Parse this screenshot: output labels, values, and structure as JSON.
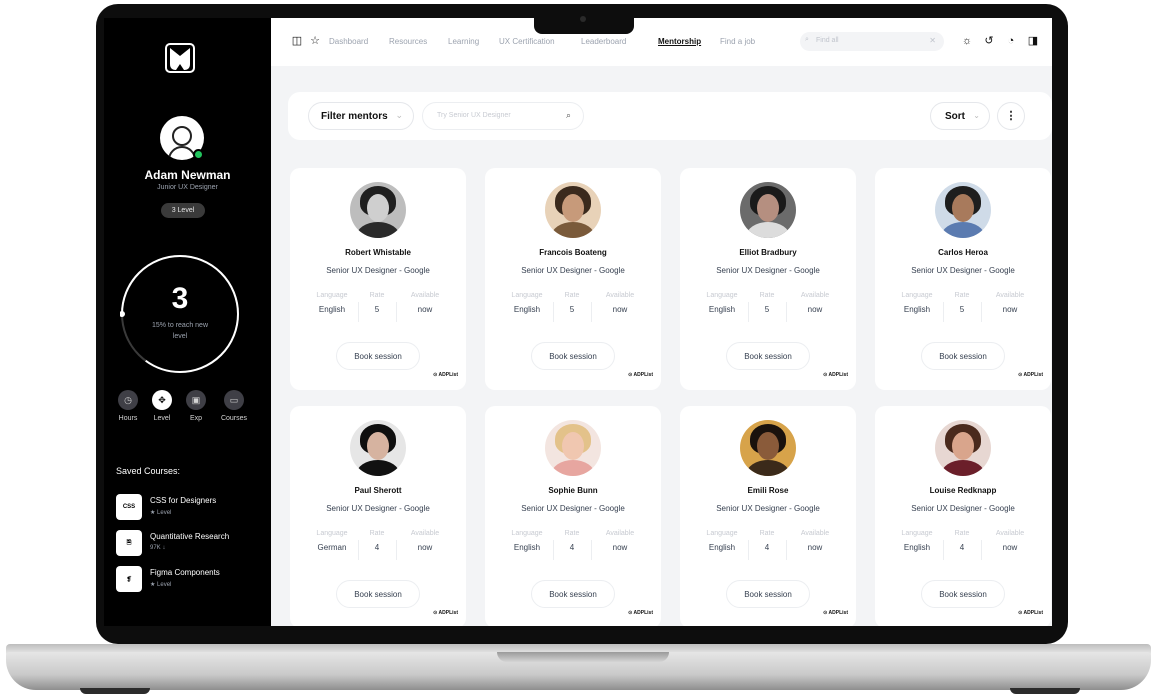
{
  "user": {
    "name": "Adam Newman",
    "role": "Junior UX Designer",
    "level_badge": "3 Level",
    "level_number": "3",
    "level_progress_text": "15% to reach new level",
    "level_progress": 0.85
  },
  "stats": [
    {
      "label": "Hours",
      "icon": "clock-icon"
    },
    {
      "label": "Level",
      "icon": "target-icon",
      "active": true
    },
    {
      "label": "Exp",
      "icon": "briefcase-icon"
    },
    {
      "label": "Courses",
      "icon": "book-icon"
    }
  ],
  "saved_courses": {
    "title": "Saved Courses:",
    "items": [
      {
        "title": "CSS for Designers",
        "meta": "★ Level",
        "icon_text": "CSS",
        "icon": "css-icon"
      },
      {
        "title": "Quantitative Research",
        "meta": "97K ↓",
        "icon_text": "",
        "icon": "document-icon"
      },
      {
        "title": "Figma Components",
        "meta": "★ Level",
        "icon_text": "",
        "icon": "figma-icon"
      }
    ]
  },
  "nav": {
    "links": [
      {
        "label": "Dashboard"
      },
      {
        "label": "Resources"
      },
      {
        "label": "Learning"
      },
      {
        "label": "UX Certification"
      },
      {
        "label": "Leaderboard"
      },
      {
        "label": "Mentorship",
        "active": true
      },
      {
        "label": "Find a job"
      }
    ],
    "search_placeholder": "Find all"
  },
  "filters": {
    "filter_label": "Filter mentors",
    "search_placeholder": "Try Senior UX Designer",
    "sort_label": "Sort"
  },
  "card_labels": {
    "language": "Language",
    "rate": "Rate",
    "available": "Available",
    "book": "Book session",
    "brand": "⊙ ADPList"
  },
  "mentors": [
    {
      "name": "Robert Whistable",
      "title": "Senior UX Designer - Google",
      "language": "English",
      "rate": "5",
      "available": "now"
    },
    {
      "name": "Francois Boateng",
      "title": "Senior UX Designer - Google",
      "language": "English",
      "rate": "5",
      "available": "now"
    },
    {
      "name": "Elliot Bradbury",
      "title": "Senior UX Designer - Google",
      "language": "English",
      "rate": "5",
      "available": "now"
    },
    {
      "name": "Carlos Heroa",
      "title": "Senior UX Designer - Google",
      "language": "English",
      "rate": "5",
      "available": "now"
    },
    {
      "name": "Paul Sherott",
      "title": "Senior UX Designer - Google",
      "language": "German",
      "rate": "4",
      "available": "now"
    },
    {
      "name": "Sophie Bunn",
      "title": "Senior UX Designer - Google",
      "language": "English",
      "rate": "4",
      "available": "now"
    },
    {
      "name": "Emili Rose",
      "title": "Senior UX Designer - Google",
      "language": "English",
      "rate": "4",
      "available": "now"
    },
    {
      "name": "Louise Redknapp",
      "title": "Senior UX Designer - Google",
      "language": "English",
      "rate": "4",
      "available": "now"
    }
  ],
  "colors": {
    "online": "#22c55e",
    "sidebar_bg": "#000000",
    "content_bg": "#f3f4f6"
  }
}
